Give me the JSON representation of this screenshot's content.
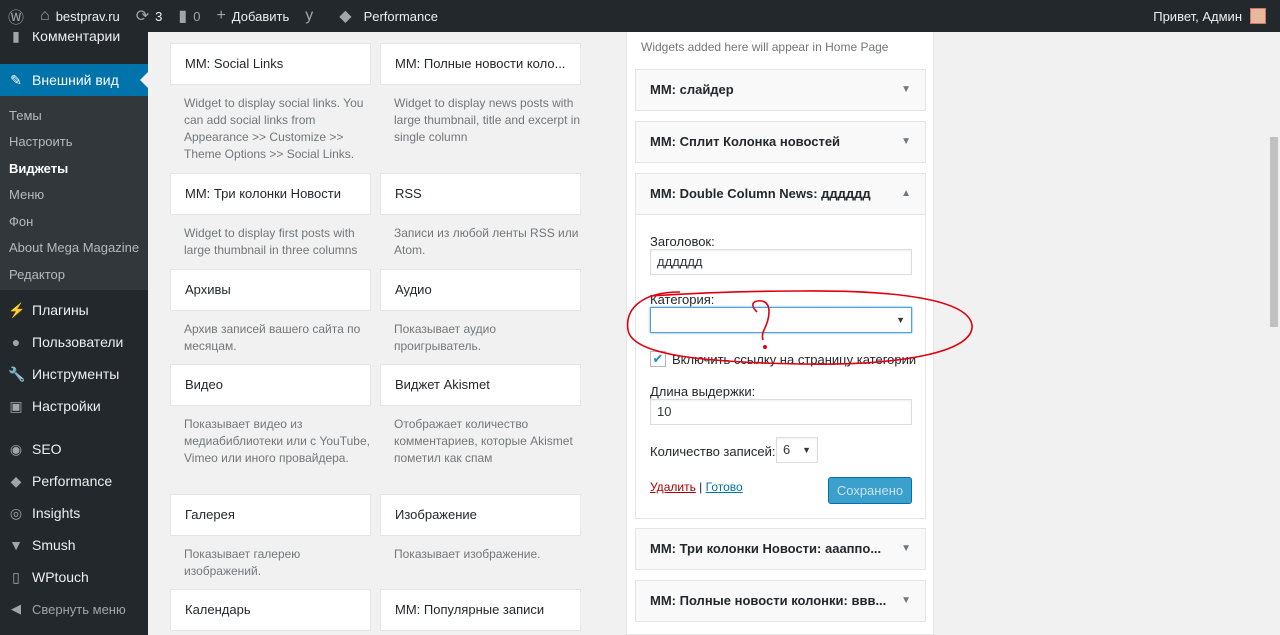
{
  "adminbar": {
    "site": "bestprav.ru",
    "updates": "3",
    "comments": "0",
    "add": "Добавить",
    "performance": "Performance",
    "greeting": "Привет, Админ"
  },
  "sidebar": {
    "items": [
      {
        "label": "Комментарии",
        "icon": "comment-icon"
      },
      {
        "label": "Внешний вид",
        "icon": "brush-icon"
      },
      {
        "label": "Плагины",
        "icon": "plugin-icon"
      },
      {
        "label": "Пользователи",
        "icon": "user-icon"
      },
      {
        "label": "Инструменты",
        "icon": "wrench-icon"
      },
      {
        "label": "Настройки",
        "icon": "settings-icon"
      },
      {
        "label": "SEO",
        "icon": "yoast-icon"
      },
      {
        "label": "Performance",
        "icon": "performance-icon"
      },
      {
        "label": "Insights",
        "icon": "insights-icon"
      },
      {
        "label": "Smush",
        "icon": "smush-icon"
      },
      {
        "label": "WPtouch",
        "icon": "phone-icon"
      },
      {
        "label": "Свернуть меню",
        "icon": "collapse-icon"
      }
    ],
    "submenu": [
      "Темы",
      "Настроить",
      "Виджеты",
      "Меню",
      "Фон",
      "About Mega Magazine",
      "Редактор"
    ]
  },
  "widgets": [
    {
      "title": "MM: Social Links",
      "desc": "Widget to display social links. You can add social links from Appearance >> Customize >> Theme Options >> Social Links."
    },
    {
      "title": "MM: Полные новости коло...",
      "desc": "Widget to display news posts with large thumbnail, title and excerpt in single column"
    },
    {
      "title": "MM: Три колонки Новости",
      "desc": "Widget to display first posts with large thumbnail in three columns"
    },
    {
      "title": "RSS",
      "desc": "Записи из любой ленты RSS или Atom."
    },
    {
      "title": "Архивы",
      "desc": "Архив записей вашего сайта по месяцам."
    },
    {
      "title": "Аудио",
      "desc": "Показывает аудио проигрыватель."
    },
    {
      "title": "Видео",
      "desc": "Показывает видео из медиабиблиотеки или с YouTube, Vimeo или иного провайдера."
    },
    {
      "title": "Виджет Akismet",
      "desc": "Отображает количество комментариев, которые Akismet пометил как спам"
    },
    {
      "title": "Галерея",
      "desc": "Показывает галерею изображений."
    },
    {
      "title": "Изображение",
      "desc": "Показывает изображение."
    },
    {
      "title": "Календарь",
      "desc": ""
    },
    {
      "title": "MM: Популярные записи",
      "desc": ""
    }
  ],
  "panel": {
    "desc": "Widgets added here will appear in Home Page",
    "top": [
      "MM: слайдер",
      "MM: Сплит Колонка новостей"
    ],
    "open": {
      "title": "MM: Double Column News: дддддд",
      "title_label": "Заголовок:",
      "title_value": "дддддд",
      "category_label": "Категория:",
      "category_value": "",
      "link_label": "Включить ссылку на страницу категории",
      "excerpt_label": "Длина выдержки:",
      "excerpt_value": "10",
      "count_label": "Количество записей:",
      "count_value": "6",
      "delete": "Удалить",
      "sep": "|",
      "done": "Готово",
      "saved": "Сохранено"
    },
    "bottom": [
      "MM: Три колонки Новости: аааппо...",
      "MM: Полные новости колонки: ввв..."
    ]
  },
  "annotation": {
    "color": "#e0000f",
    "mark": "?"
  }
}
